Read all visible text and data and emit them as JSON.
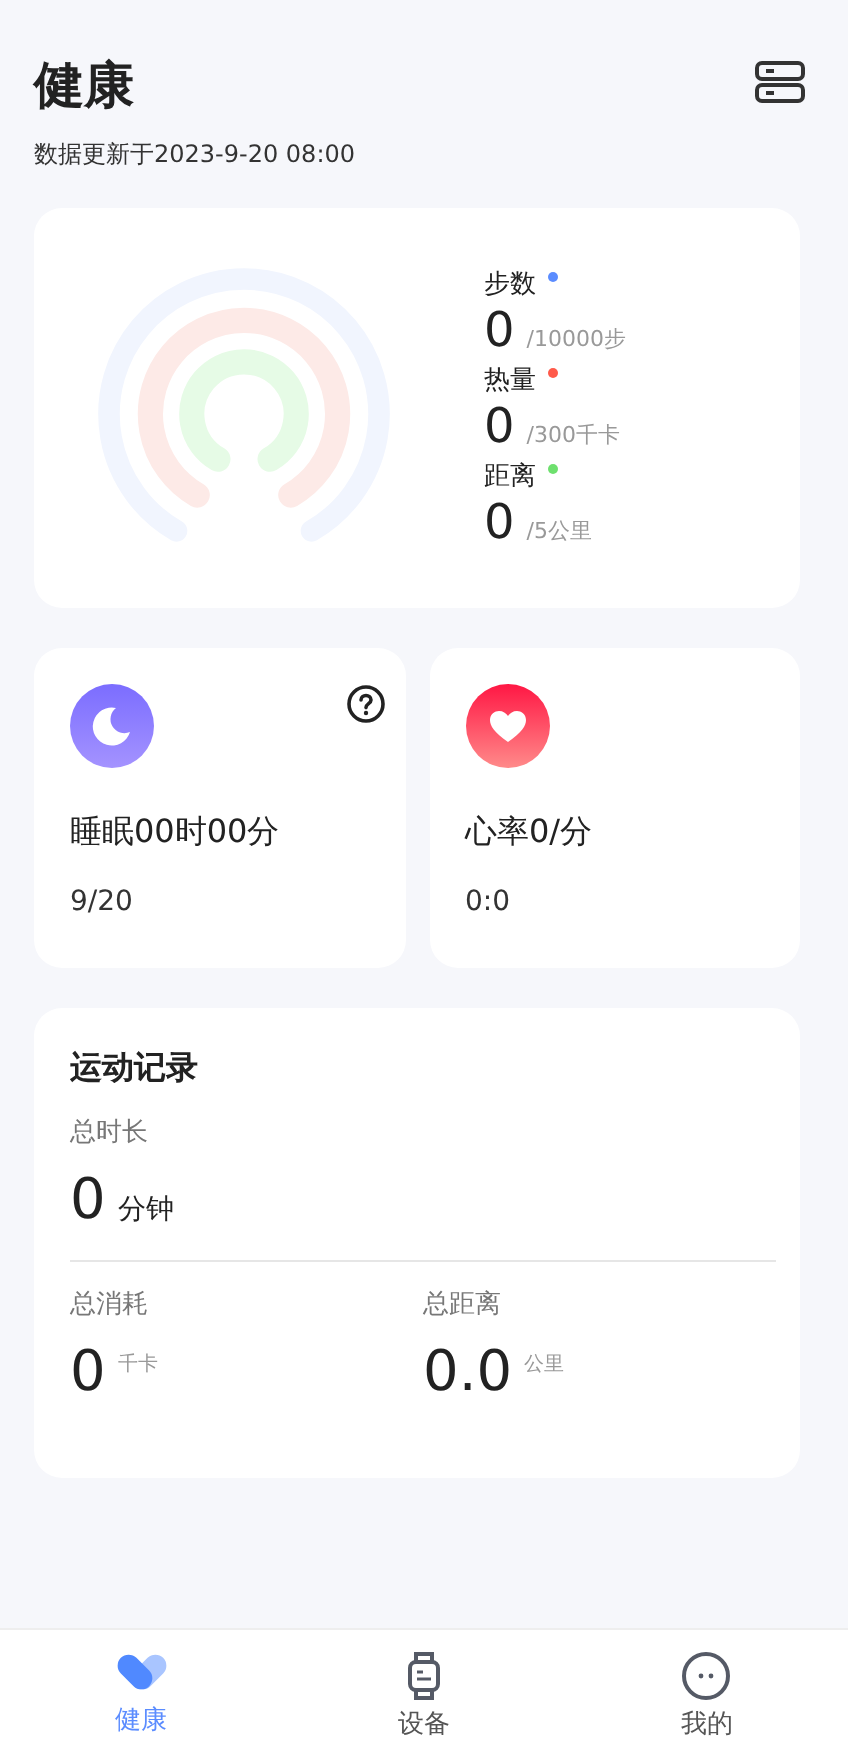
{
  "header": {
    "title": "健康",
    "updated": "数据更新于2023-9-20 08:00"
  },
  "activity": {
    "metrics": [
      {
        "label": "步数",
        "color": "#5b8cff",
        "value": "0",
        "goal": "/10000步"
      },
      {
        "label": "热量",
        "color": "#ff5a4a",
        "value": "0",
        "goal": "/300千卡"
      },
      {
        "label": "距离",
        "color": "#6ee06e",
        "value": "0",
        "goal": "/5公里"
      }
    ]
  },
  "cards": [
    {
      "kind": "sleep",
      "title": "睡眠00时00分",
      "detail": "9/20",
      "help": true
    },
    {
      "kind": "heart",
      "title": "心率0/分",
      "detail": "0:0",
      "help": false
    }
  ],
  "exercise": {
    "title": "运动记录",
    "duration_label": "总时长",
    "duration_value": "0",
    "duration_unit": "分钟",
    "stats": [
      {
        "label": "总消耗",
        "value": "0",
        "unit": "千卡"
      },
      {
        "label": "总距离",
        "value": "0.0",
        "unit": "公里"
      }
    ]
  },
  "tabs": [
    {
      "label": "健康",
      "selected": true,
      "kind": "health"
    },
    {
      "label": "设备",
      "selected": false,
      "kind": "device"
    },
    {
      "label": "我的",
      "selected": false,
      "kind": "me"
    }
  ]
}
